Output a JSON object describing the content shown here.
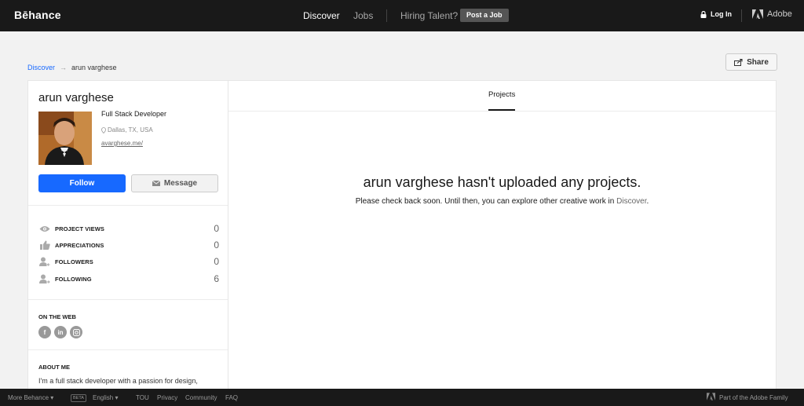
{
  "nav": {
    "logo": "Bēhance",
    "discover": "Discover",
    "jobs": "Jobs",
    "hiring": "Hiring Talent?",
    "post_job": "Post a Job",
    "login": "Log In",
    "adobe": "Adobe"
  },
  "breadcrumb": {
    "root": "Discover",
    "arrow": "→",
    "current": "arun varghese"
  },
  "share_label": "Share",
  "profile": {
    "name": "arun varghese",
    "occupation": "Full Stack Developer",
    "location": "Dallas, TX, USA",
    "website": "avarghese.me/",
    "follow_label": "Follow",
    "message_label": "Message"
  },
  "stats": [
    {
      "label": "PROJECT VIEWS",
      "value": "0",
      "icon": "eye-icon"
    },
    {
      "label": "APPRECIATIONS",
      "value": "0",
      "icon": "thumbs-up-icon"
    },
    {
      "label": "FOLLOWERS",
      "value": "0",
      "icon": "followers-icon"
    },
    {
      "label": "FOLLOWING",
      "value": "6",
      "icon": "following-icon"
    }
  ],
  "on_the_web": {
    "title": "ON THE WEB",
    "icons": [
      "facebook-icon",
      "linkedin-icon",
      "instagram-icon"
    ]
  },
  "about": {
    "title": "ABOUT ME",
    "text": "I'm a full stack developer with a passion for design,"
  },
  "main": {
    "tab": "Projects",
    "empty_title": "arun varghese hasn't uploaded any projects.",
    "empty_sub_prefix": "Please check back soon. Until then, you can explore other creative work in ",
    "empty_sub_link": "Discover",
    "empty_sub_suffix": "."
  },
  "footer": {
    "more": "More Behance",
    "beta": "BETA",
    "language": "English",
    "tou": "TOU",
    "privacy": "Privacy",
    "community": "Community",
    "faq": "FAQ",
    "adobe_family": "Part of the Adobe Family"
  },
  "colors": {
    "accent": "#1769ff",
    "topbar": "#191919"
  }
}
